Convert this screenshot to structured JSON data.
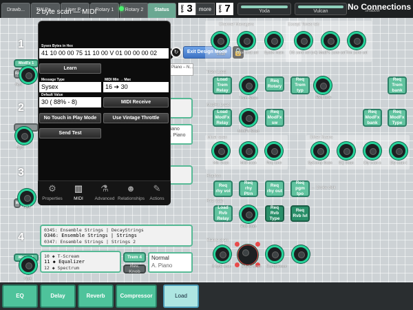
{
  "topbar": {
    "tabs": [
      "Drawb...",
      "TW Pa...",
      "User P...",
      "Rotary 1",
      "Rotary 2",
      "Status"
    ],
    "active_tab": "Status",
    "bank_label": "bank",
    "bank_left": "3",
    "more_label": "more",
    "bank_right": "7",
    "slot1_label": "Yoda",
    "slot2_label": "Vulcan",
    "connection_status": "No Connections",
    "shadow_label": "Shadow"
  },
  "popover": {
    "title": "2 byte scan — MIDI",
    "sysex_label": "Sysex Bytes in Hex",
    "sysex_value": "41 10 00 00 75 11 10 00 V 01 00 00 00 02",
    "learn_button": "Learn",
    "message_type_label": "Message Type",
    "message_type_value": "Sysex",
    "midi_minmax_label": "MIDI Min → Max",
    "midi_min": "16",
    "midi_arrow": "➔",
    "midi_max": "30",
    "default_label": "Default Value",
    "default_value": "30 ( 88% - 8)",
    "midi_receive_button": "MIDI Receive",
    "no_touch_button": "No Touch in Play Mode",
    "vintage_button": "Use Vintage Throttle",
    "send_test_button": "Send Test",
    "tabs": [
      {
        "label": "Properties",
        "icon": "⚙"
      },
      {
        "label": "MIDI",
        "icon": "▥"
      },
      {
        "label": "Advanced",
        "icon": "⚗"
      },
      {
        "label": "Relationships",
        "icon": "☻"
      },
      {
        "label": "Actions",
        "icon": "✎"
      }
    ],
    "active_tab": "MIDI"
  },
  "toolbar": {
    "exit_design": "Exit Design Mode",
    "lock_icon": "🔒",
    "refresh_icon": "↻"
  },
  "left": {
    "slots": [
      "1",
      "2",
      "3",
      "4"
    ],
    "slot1_modfx": "ModFx 1",
    "slot1_gp": "Gp1",
    "slot1_fx": "Fx",
    "slot1_snip": "Piano – N...",
    "slot2_gp": "Gp2",
    "slot2_snip": "Piano",
    "slot2_snip2": "A. Piano",
    "slot3_gp": "Gp3",
    "slot3_m": "M",
    "slot4_modfx": "ModFx 1",
    "slot4_gp": "Gp4",
    "slot4_list": [
      "0345: Ensemble Strings | DecayStrings",
      "0346: Ensemble Strings | Strings",
      "0347: Ensemble Strings | Strings 2"
    ],
    "slot4_fx_list": [
      "10 ◆ T-Scream",
      "11 ◆ Equalizer",
      "12 ◆ Spectrum"
    ],
    "trem_button": "Trem 4",
    "fx_type": "Normal",
    "fx_type2": "A. Piano",
    "dark_button": "Rev. Knob"
  },
  "right": {
    "channel_managers": "Channel Managers",
    "except_tones": "Except Tones tab",
    "row1_knobs": [
      "Load",
      "Gain seat sel",
      "Sysex main",
      "DB zone sel (v4)",
      "ModFx zone sel",
      "Trm zone sel"
    ],
    "trem_load": "Trem Load",
    "trem_buttons": [
      "Load Trem Relay",
      "Req Rotary",
      "Req Trem typ",
      "Req Trem bank"
    ],
    "trem_knob_labels": [
      "Trem Scan",
      "Req tone"
    ],
    "modfx_load": "ModFx Load",
    "modfx_buttons": [
      "Load ModFx Relay",
      "Req ModFx sw",
      "Req ModFx bank",
      "Req ModFx Type"
    ],
    "modfx_knob_label": "ModFx Scan",
    "mixer_scan": "Mixer scan",
    "other_scans": "Other Scans",
    "mixer_knobs": [
      "Mix Scan",
      "Midi scan",
      "Req tone",
      "SyComp Scan",
      "EQ Scan",
      "Dly scan s",
      "Dly scan t"
    ],
    "rhythm": "Rhythm",
    "rhythm_buttons": [
      "Req rhy vol",
      "Req rhy Ptrn",
      "Req rhy out",
      "Req pgm tpo"
    ],
    "broke_dick": "← Broke dick",
    "rvb_scan": "Rvb scan",
    "rvb_buttons": [
      "Load Rvb Relay",
      "Req Rvb Type",
      "Req Rvb lvl"
    ],
    "rvb_knob_label": "Rvb scan",
    "status_scan": "Status scan",
    "status_knobs": [
      "3 byte scan",
      "2 byte scan",
      "Compressor"
    ]
  },
  "bottom": {
    "buttons": [
      "EQ",
      "Delay",
      "Reverb",
      "Compressor",
      "Load"
    ]
  },
  "colors": {
    "accent": "#61c39f",
    "knob_ring": "#27d39a",
    "popover_bg": "#0c0c0c",
    "exit_blue": "#3d73c4"
  }
}
